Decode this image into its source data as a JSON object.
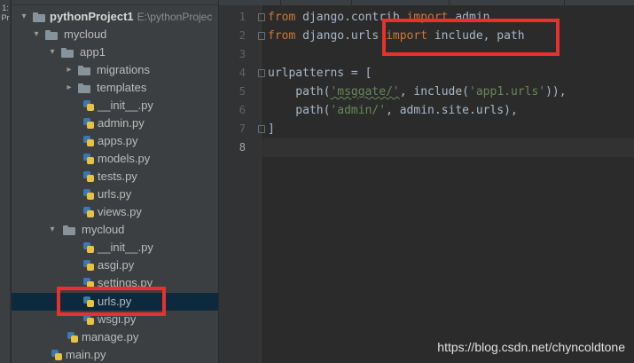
{
  "sidebar_strip": {
    "vertical_label": "1: Pr"
  },
  "project_tree": {
    "root": {
      "name": "pythonProject1",
      "path": "E:\\pythonProjec"
    },
    "items": [
      {
        "label": "mycloud",
        "type": "folder",
        "expanded": true
      },
      {
        "label": "app1",
        "type": "folder",
        "expanded": true
      },
      {
        "label": "migrations",
        "type": "folder",
        "expanded": false
      },
      {
        "label": "templates",
        "type": "folder",
        "expanded": false
      },
      {
        "label": "__init__.py",
        "type": "py"
      },
      {
        "label": "admin.py",
        "type": "py"
      },
      {
        "label": "apps.py",
        "type": "py"
      },
      {
        "label": "models.py",
        "type": "py"
      },
      {
        "label": "tests.py",
        "type": "py"
      },
      {
        "label": "urls.py",
        "type": "py"
      },
      {
        "label": "views.py",
        "type": "py"
      },
      {
        "label": "mycloud",
        "type": "folder",
        "expanded": true
      },
      {
        "label": "__init__.py",
        "type": "py"
      },
      {
        "label": "asgi.py",
        "type": "py"
      },
      {
        "label": "settings.py",
        "type": "py"
      },
      {
        "label": "urls.py",
        "type": "py",
        "selected": true
      },
      {
        "label": "wsgi.py",
        "type": "py"
      },
      {
        "label": "manage.py",
        "type": "py"
      },
      {
        "label": "main.py",
        "type": "py"
      }
    ]
  },
  "editor": {
    "line_numbers": [
      "1",
      "2",
      "3",
      "4",
      "5",
      "6",
      "7",
      "8"
    ],
    "current_line": "8",
    "code": {
      "l1_kw1": "from",
      "l1_mod": " django.contrib ",
      "l1_kw2": "import",
      "l1_name": " admin",
      "l2_kw1": "from",
      "l2_mod": " django.urls ",
      "l2_kw2": "import",
      "l2_names": " include, path",
      "l4": "urlpatterns = [",
      "l5_a": "    path(",
      "l5_s1": "'msggate/'",
      "l5_b": ", include(",
      "l5_s2": "'app1.urls'",
      "l5_c": ")),",
      "l6_a": "    path(",
      "l6_s1": "'admin/'",
      "l6_b": ", admin.site.urls),",
      "l7": "]"
    }
  },
  "watermark": "https://blog.csdn.net/chyncoldtone",
  "colors": {
    "keyword": "#cc7832",
    "string": "#6a8759",
    "text": "#a9b7c6",
    "highlight_box": "#e8302c",
    "selection": "#0d293e"
  }
}
